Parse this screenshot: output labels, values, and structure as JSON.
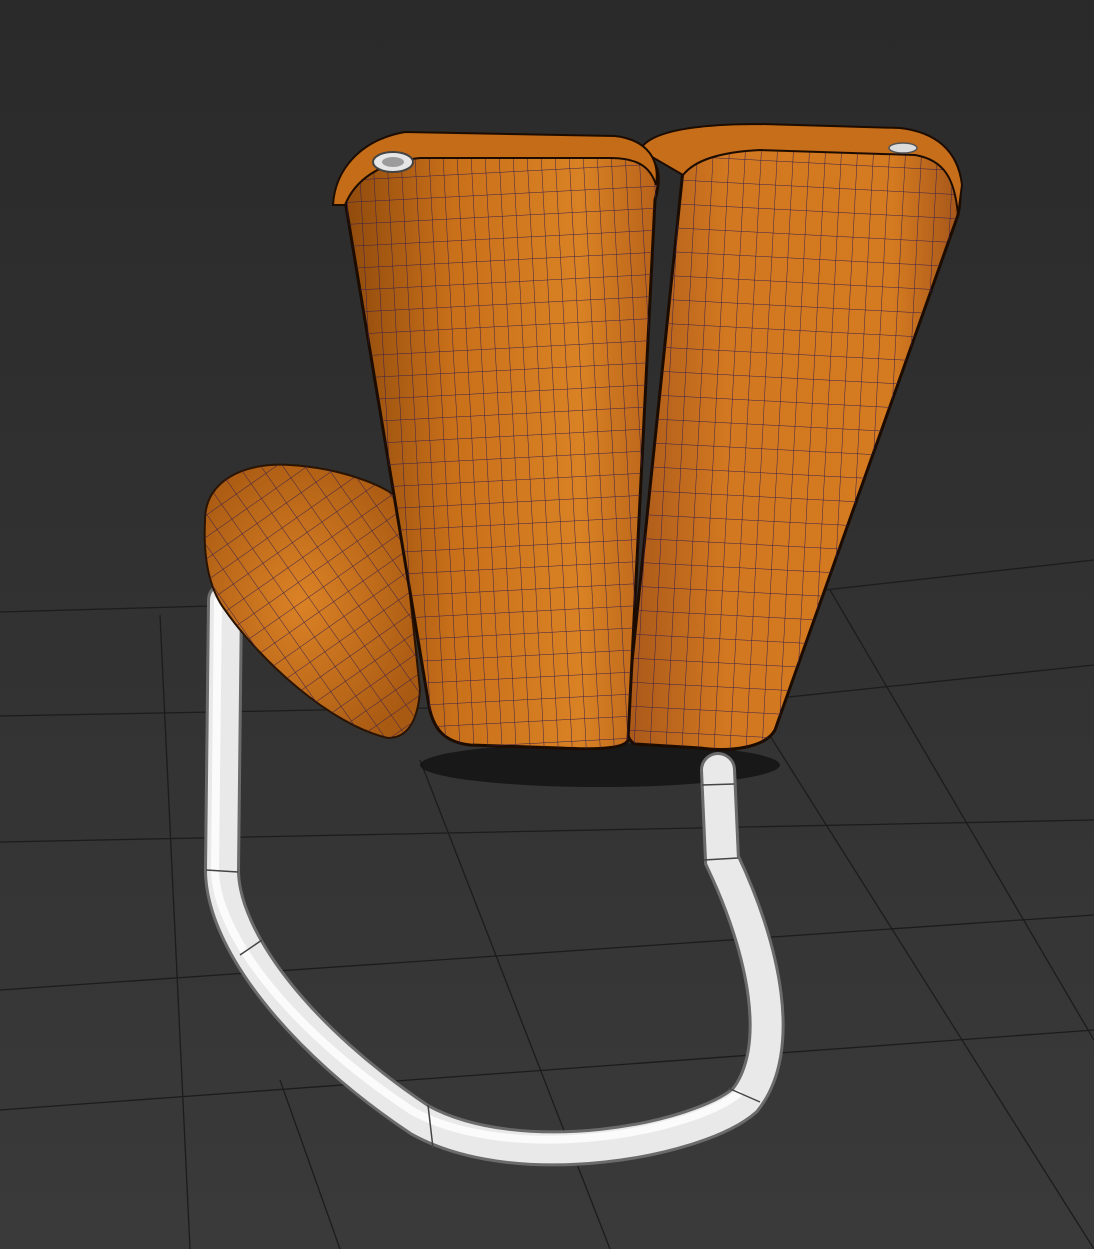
{
  "viewport": {
    "view_type": "perspective",
    "shading": "wireframe-over-shaded",
    "background_color": "#2e2e2e",
    "grid_color": "#1e1e1e"
  },
  "model": {
    "object": "chair",
    "parts": [
      "backrest-left-cushion",
      "backrest-right-cushion",
      "seat-cushion",
      "tubular-frame"
    ],
    "cushion_color": "#d0751a",
    "wire_color": "#3a1f4a",
    "frame_color": "#e8e8e8"
  }
}
